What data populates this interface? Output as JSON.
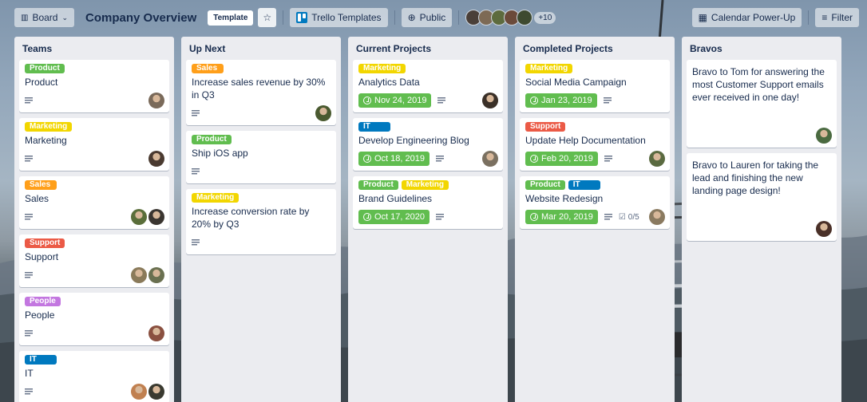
{
  "colors": {
    "Product": "#61bd4f",
    "Marketing": "#f2d600",
    "Sales": "#ff9f1a",
    "Support": "#eb5a46",
    "People": "#c377e0",
    "IT": "#0079bf"
  },
  "header": {
    "board_menu": "Board",
    "title": "Company Overview",
    "template_badge": "Template",
    "templates_link": "Trello Templates",
    "visibility": "Public",
    "more_members": "+10",
    "calendar": "Calendar Power-Up",
    "filter": "Filter"
  },
  "lists": [
    {
      "title": "Teams",
      "cards": [
        {
          "labels": [
            "Product"
          ],
          "title": "Product",
          "members": [
            "#7a6a5a"
          ]
        },
        {
          "labels": [
            "Marketing"
          ],
          "title": "Marketing",
          "members": [
            "#4a3a30"
          ]
        },
        {
          "labels": [
            "Sales"
          ],
          "title": "Sales",
          "members": [
            "#5a6e3a",
            "#3a3530"
          ]
        },
        {
          "labels": [
            "Support"
          ],
          "title": "Support",
          "members": [
            "#8a7a5a",
            "#6a7050"
          ]
        },
        {
          "labels": [
            "People"
          ],
          "title": "People",
          "members": [
            "#8a5040"
          ]
        },
        {
          "labels": [
            "IT"
          ],
          "title": "IT",
          "members": [
            "#c08050",
            "#3a3a30"
          ]
        }
      ]
    },
    {
      "title": "Up Next",
      "cards": [
        {
          "labels": [
            "Sales"
          ],
          "title": "Increase sales revenue by 30% in Q3",
          "members": [
            "#4a5a30"
          ]
        },
        {
          "labels": [
            "Product"
          ],
          "title": "Ship iOS app",
          "members": []
        },
        {
          "labels": [
            "Marketing"
          ],
          "title": "Increase conversion rate by 20% by Q3",
          "members": []
        }
      ]
    },
    {
      "title": "Current Projects",
      "cards": [
        {
          "labels": [
            "Marketing"
          ],
          "title": "Analytics Data",
          "due": "Nov 24, 2019",
          "members": [
            "#3a3028"
          ]
        },
        {
          "labels": [
            "IT"
          ],
          "title": "Develop Engineering Blog",
          "due": "Oct 18, 2019",
          "members": [
            "#7a7060"
          ]
        },
        {
          "labels": [
            "Product",
            "Marketing"
          ],
          "title": "Brand Guidelines",
          "due": "Oct 17, 2020",
          "members": []
        }
      ]
    },
    {
      "title": "Completed Projects",
      "cards": [
        {
          "labels": [
            "Marketing"
          ],
          "title": "Social Media Campaign",
          "due": "Jan 23, 2019",
          "members": []
        },
        {
          "labels": [
            "Support"
          ],
          "title": "Update Help Documentation",
          "due": "Feb 20, 2019",
          "members": [
            "#5a6a40"
          ]
        },
        {
          "labels": [
            "Product",
            "IT"
          ],
          "title": "Website Redesign",
          "due": "Mar 20, 2019",
          "checklist": "0/5",
          "members": [
            "#8a7a60"
          ]
        }
      ]
    },
    {
      "title": "Bravos",
      "cards": [
        {
          "labels": [],
          "title": "Bravo to Tom for answering the most Customer Support emails ever received in one day!",
          "members": [
            "#4a6a40"
          ]
        },
        {
          "labels": [],
          "title": "Bravo to Lauren for taking the lead and finishing the new landing page design!",
          "members": [
            "#4a3028"
          ]
        }
      ]
    }
  ]
}
